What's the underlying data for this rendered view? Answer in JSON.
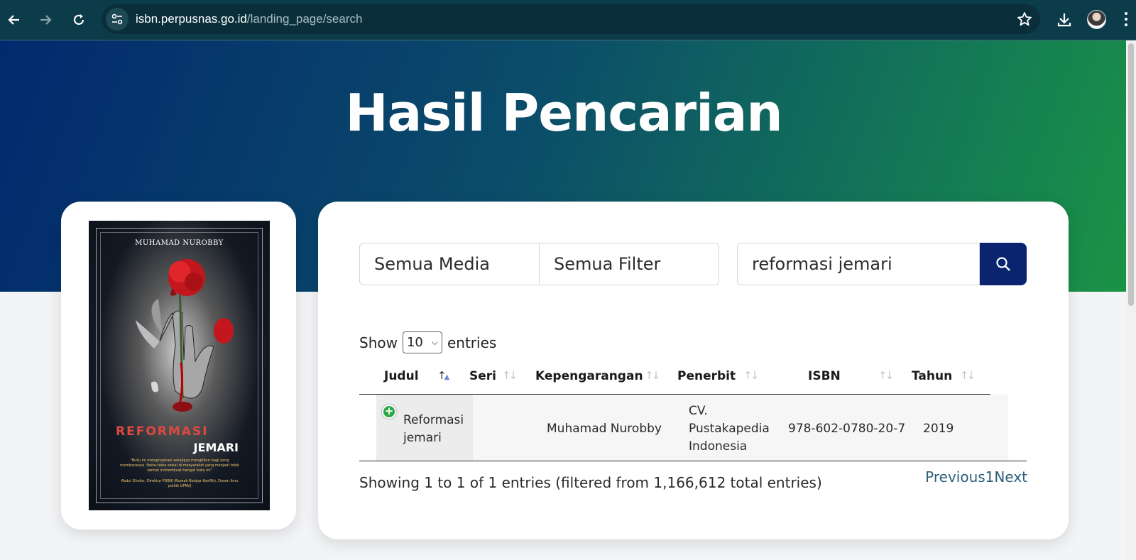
{
  "browser": {
    "url_host": "isbn.perpusnas.go.id",
    "url_path": "/landing_page/search",
    "back_icon": "arrow-left-icon",
    "forward_icon": "arrow-right-icon",
    "reload_icon": "reload-icon",
    "site_info_icon": "tune-icon",
    "bookmark_icon": "star-icon",
    "download_icon": "download-icon",
    "menu_icon": "kebab-menu-icon"
  },
  "hero": {
    "title": "Hasil Pencarian"
  },
  "cover": {
    "author": "MUHAMAD NUROBBY",
    "title_line1": "REFORMASI",
    "title_line2": "JEMARI",
    "quote": "\"Buku ini menginspirasi sekaligus menghibur bagi yang membacanya. Fakta-fakta sosial di masyarakat yang menjadi tolok sentak inimembuat hangat buku ini\"",
    "credit": "Abdul Ghofur, Direktur PUBIK (Rumah Belajar Konflik), Dosen ilmu politik UPNVJ"
  },
  "search": {
    "media": "Semua Media",
    "filter": "Semua Filter",
    "query": "reformasi jemari",
    "button_icon": "search-icon"
  },
  "table_controls": {
    "show_label": "Show",
    "entries_value": "10",
    "entries_label": "entries"
  },
  "table": {
    "columns": [
      "Judul",
      "Seri",
      "Kepengarangan",
      "Penerbit",
      "ISBN",
      "Tahun"
    ],
    "sorted_column": "Judul",
    "rows": [
      {
        "judul_line1": "Reformasi",
        "judul_line2": "jemari",
        "seri": "",
        "kepengarangan": "Muhamad Nurobby",
        "penerbit_line1": "CV.",
        "penerbit_line2": "Pustakapedia",
        "penerbit_line3": "Indonesia",
        "isbn": "978-602-0780-20-7",
        "tahun": "2019"
      }
    ]
  },
  "footer": {
    "info": "Showing 1 to 1 of 1 entries (filtered from 1,166,612 total entries)",
    "previous": "Previous",
    "page": "1",
    "next": "Next"
  },
  "colors": {
    "hero_start": "#02296e",
    "hero_end": "#1b9445",
    "search_button": "#0b2470",
    "pager_link": "#2b5f7a",
    "expand_button": "#2ea643"
  }
}
